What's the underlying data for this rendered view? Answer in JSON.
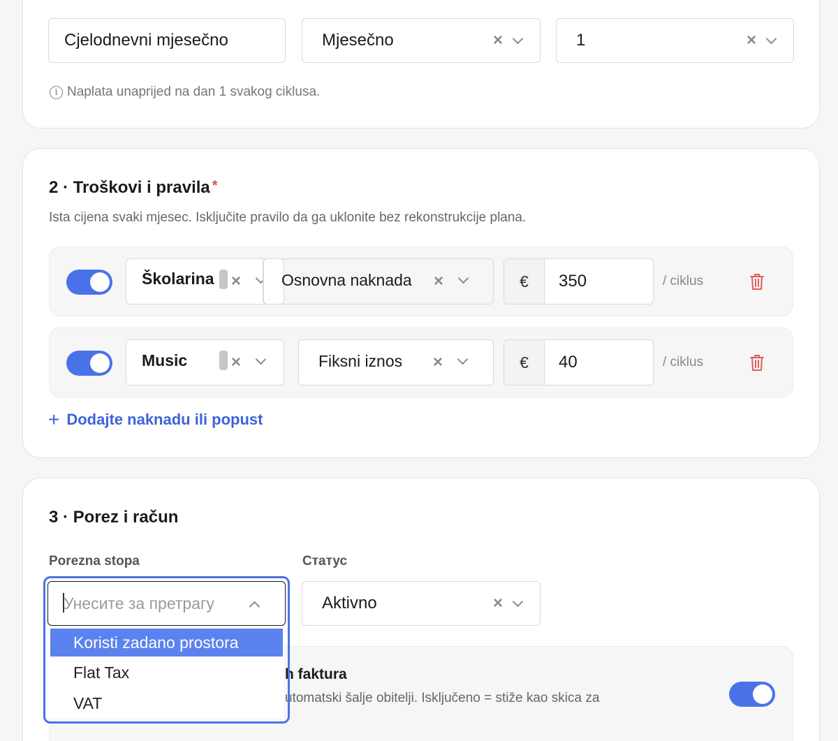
{
  "section1": {
    "plan_name_value": "Cjelodnevni mjesečno",
    "cycle_value": "Mjesečno",
    "day_value": "1",
    "hint_text": "Naplata unaprijed na dan 1 svakog ciklusa."
  },
  "section2": {
    "title": "2 · Troškovi i pravila",
    "required_mark": "*",
    "subtitle": "Ista cijena svaki mjesec. Isključite pravilo da ga uklonite bez rekonstrukcije plana.",
    "rules": [
      {
        "enabled": true,
        "category": "Školarina",
        "type": "Osnovna naknada",
        "currency": "€",
        "amount": "350",
        "per": "/ ciklus"
      },
      {
        "enabled": true,
        "category": "Music",
        "type": "Fiksni iznos",
        "currency": "€",
        "amount": "40",
        "per": "/ ciklus"
      }
    ],
    "add_label": "Dodajte naknadu ili popust"
  },
  "section3": {
    "title": "3 · Porez i račun",
    "tax_label": "Porezna stopa",
    "status_label": "Статус",
    "tax_search_placeholder": "Унесите за претрагу",
    "tax_options": [
      "Koristi zadano prostora",
      "Flat Tax",
      "VAT"
    ],
    "tax_selected_index": 0,
    "status_value": "Aktivno",
    "invoice_title_partial": "h faktura",
    "invoice_desc_partial": "utomatski šalje obitelji. Isključeno = stiže kao skica za",
    "invoice_toggle_on": true
  },
  "colors": {
    "accent": "#4a72e8",
    "link": "#3d63d9",
    "danger": "#e05a5a",
    "selected_option": "#5b82ee"
  }
}
